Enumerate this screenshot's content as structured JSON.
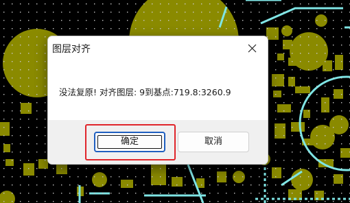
{
  "dialog": {
    "title": "图层对齐",
    "message": "没法复原! 对齐图层: 9到基点:719.8:3260.9",
    "ok_label": "确定",
    "cancel_label": "取消"
  },
  "icons": {
    "close": "close-icon"
  },
  "colors": {
    "pcb_background": "#000000",
    "pad_olive": "#8a8a00",
    "trace_cyan": "#7fe5e5",
    "grid_dot": "#c8c8c8",
    "dialog_background": "#ffffff",
    "dialog_footer": "#f0f0f0",
    "ok_border": "#1f5fbf",
    "highlight_red": "#e0242a"
  }
}
